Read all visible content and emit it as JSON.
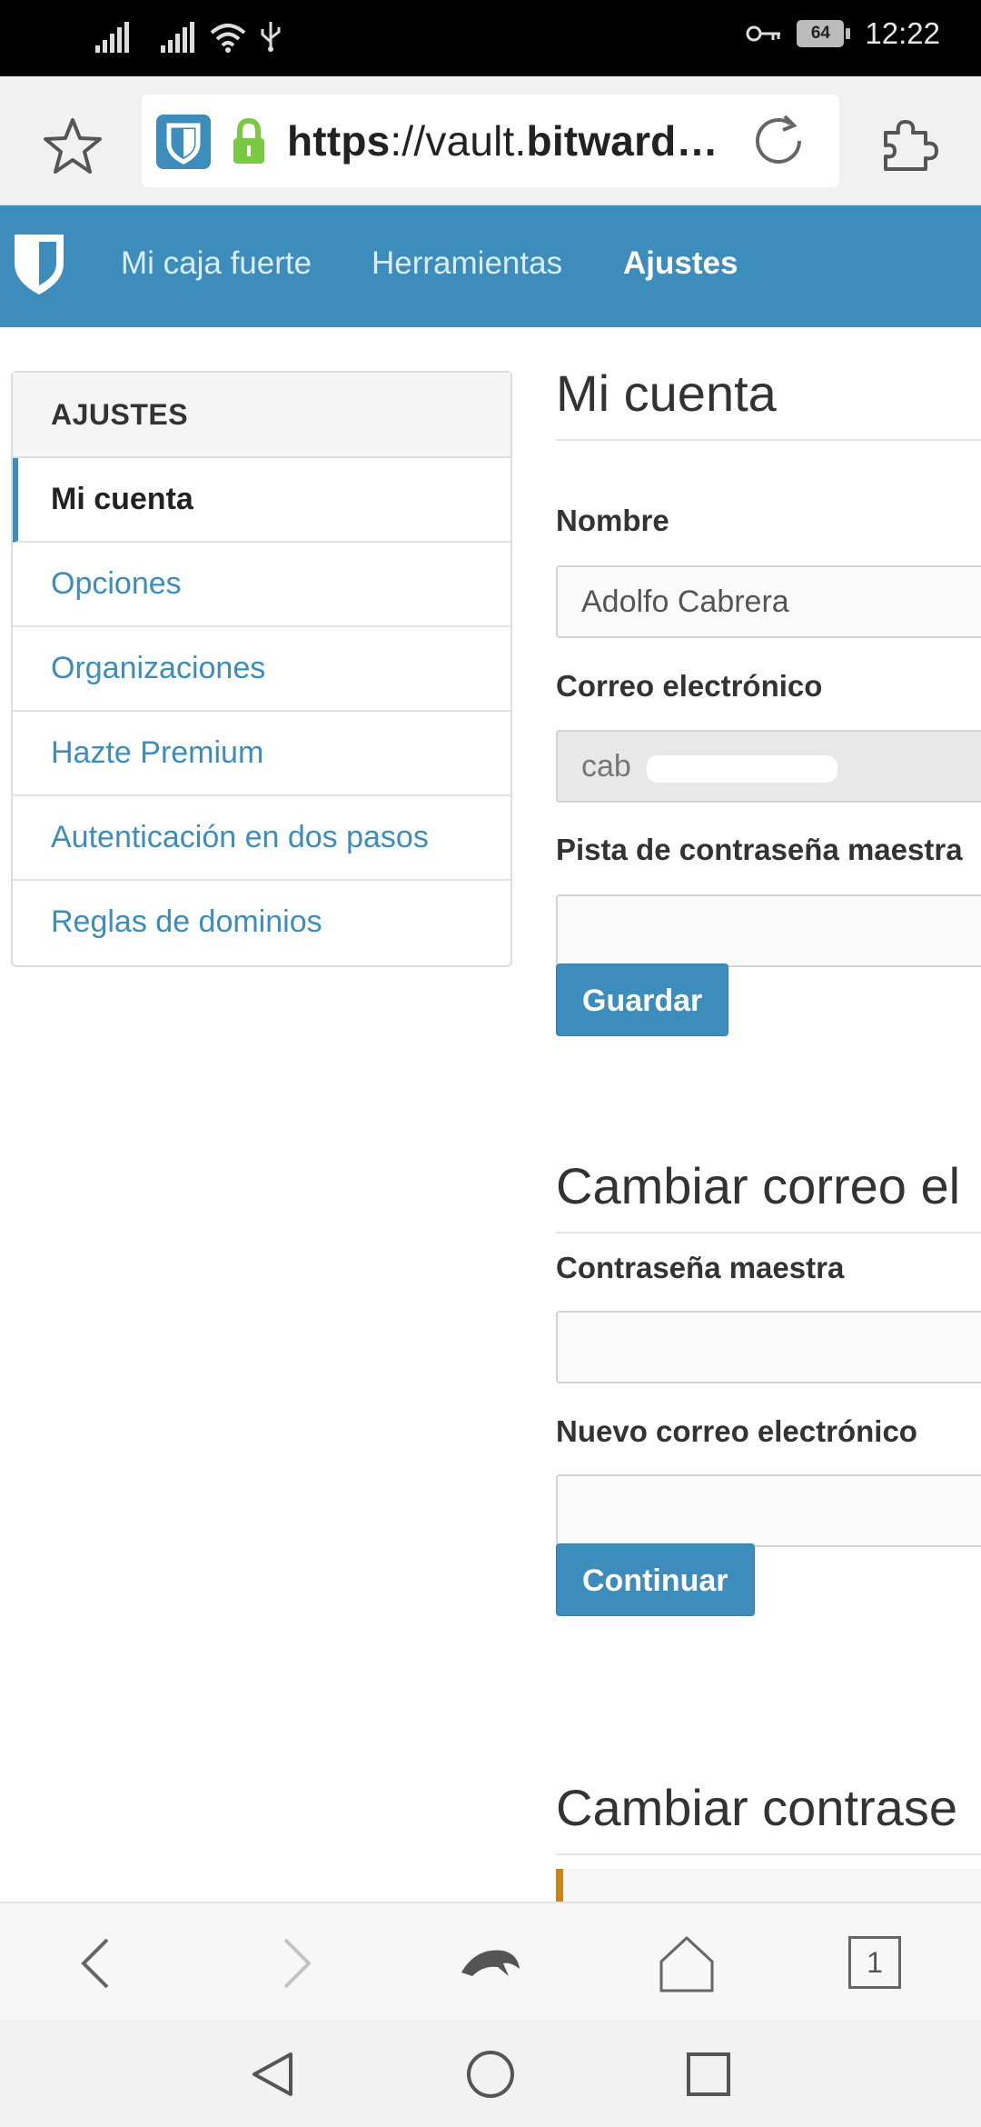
{
  "status_bar": {
    "time": "12:22",
    "battery": "64",
    "icons": [
      "signal-icon",
      "signal-icon",
      "wifi-icon",
      "usb-icon",
      "key-icon",
      "battery-icon"
    ]
  },
  "browser": {
    "url_scheme": "https",
    "url_rest": "://vault.",
    "url_domain": "bitward…",
    "icons": [
      "star-icon",
      "bitwarden-favicon",
      "lock-icon",
      "reload-icon",
      "extension-icon"
    ]
  },
  "app_nav": {
    "links": [
      "Mi caja fuerte",
      "Herramientas",
      "Ajustes"
    ],
    "active": "Ajustes"
  },
  "sidebar": {
    "header": "AJUSTES",
    "items": [
      {
        "label": "Mi cuenta",
        "active": true
      },
      {
        "label": "Opciones"
      },
      {
        "label": "Organizaciones"
      },
      {
        "label": "Hazte Premium"
      },
      {
        "label": "Autenticación en dos pasos"
      },
      {
        "label": "Reglas de dominios"
      }
    ]
  },
  "account": {
    "title": "Mi cuenta",
    "name_label": "Nombre",
    "name_value": "Adolfo Cabrera",
    "email_label": "Correo electrónico",
    "email_value": "cab",
    "hint_label": "Pista de contraseña maestra",
    "hint_value": "",
    "save_button": "Guardar"
  },
  "change_email": {
    "title": "Cambiar correo el",
    "master_password_label": "Contraseña maestra",
    "master_password_value": "",
    "new_email_label": "Nuevo correo electrónico",
    "new_email_value": "",
    "continue_button": "Continuar"
  },
  "change_password": {
    "title": "Cambiar contrase"
  },
  "bottom_nav": {
    "tab_count": "1",
    "icons": [
      "back-icon",
      "forward-icon",
      "dolphin-icon",
      "home-icon",
      "tabs-icon"
    ]
  },
  "system_nav": {
    "icons": [
      "back-triangle-icon",
      "home-circle-icon",
      "recents-square-icon"
    ]
  },
  "colors": {
    "brand": "#3c8dbc",
    "accent_warning": "#c8851a"
  }
}
